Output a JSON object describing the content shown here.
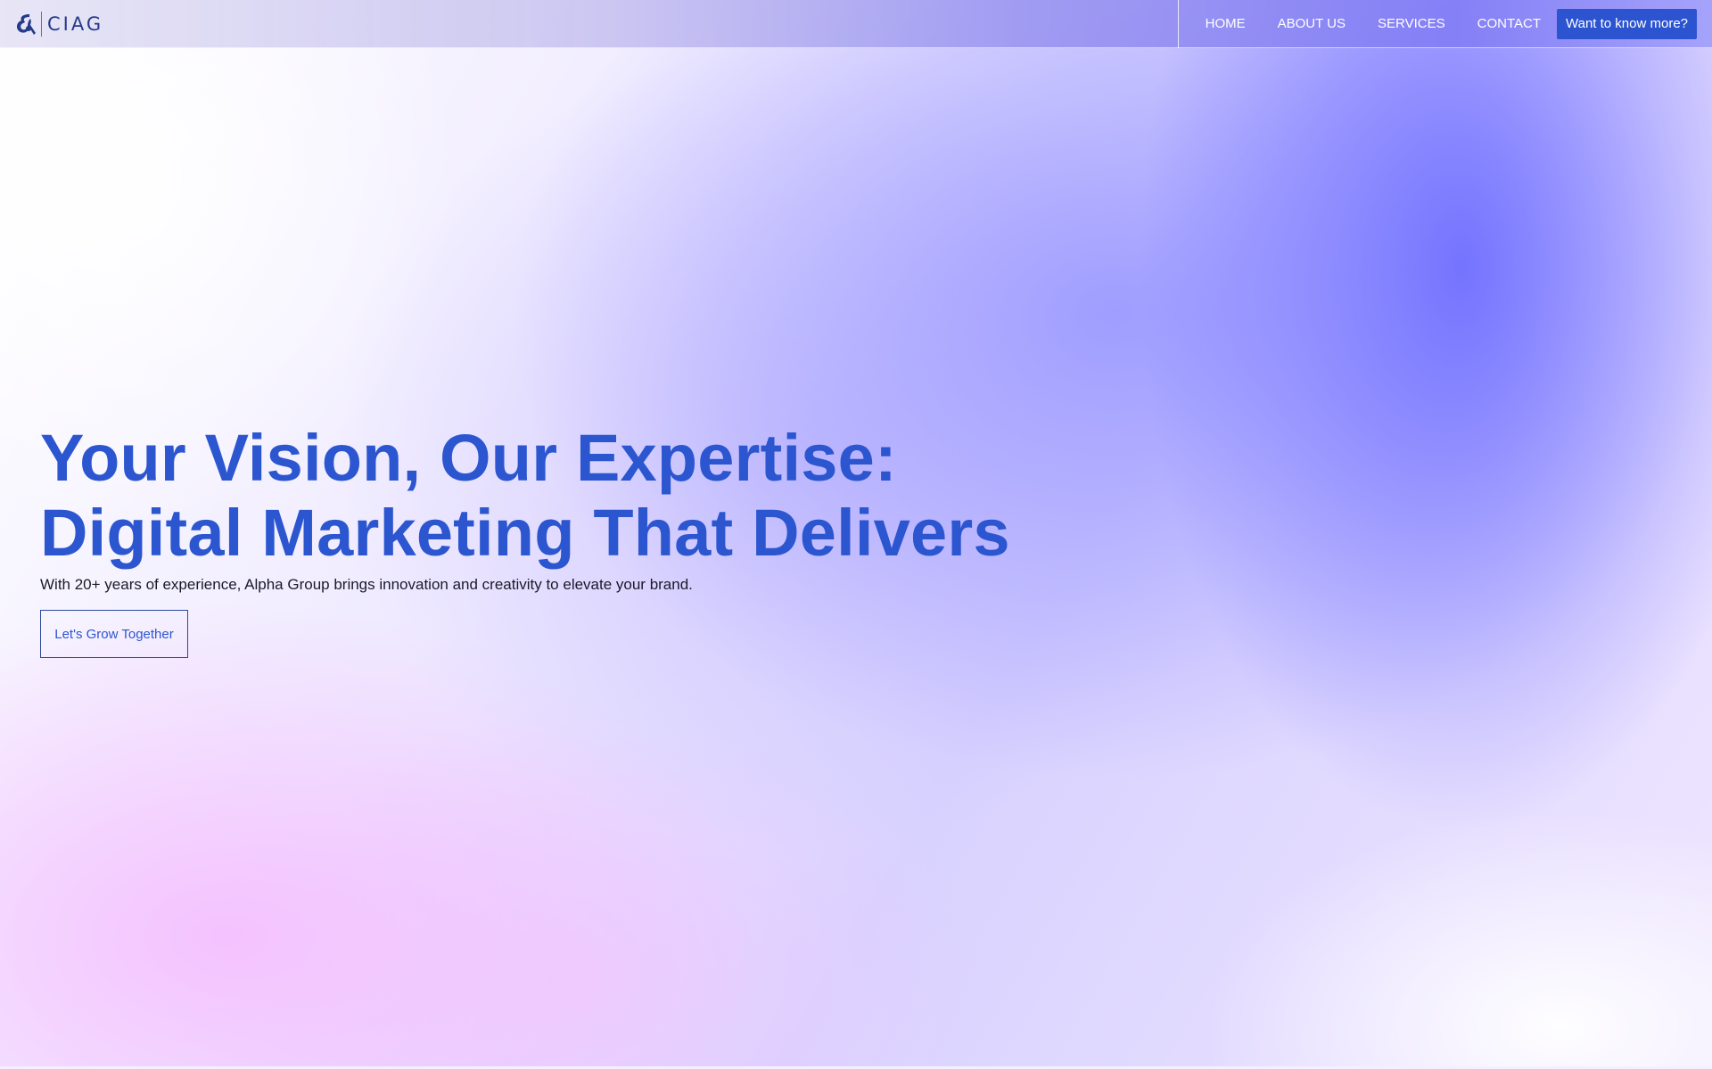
{
  "brand": {
    "name": "CIAG",
    "logo_icon": "alpha-ampersand-logo-icon",
    "color": "#263a8c"
  },
  "nav": {
    "items": [
      {
        "label": "HOME"
      },
      {
        "label": "ABOUT US"
      },
      {
        "label": "SERVICES"
      },
      {
        "label": "CONTACT"
      }
    ],
    "cta_label": "Want to know more?"
  },
  "hero": {
    "title_line1": "Your Vision, Our Expertise:",
    "title_line2": "Digital Marketing That Delivers",
    "subtitle": "With 20+ years of experience, Alpha Group brings innovation and creativity to elevate your brand.",
    "button_label": "Let's Grow Together"
  },
  "colors": {
    "accent": "#2c56d0",
    "cta_bg": "#2c54d1",
    "text": "#1a1a2a"
  }
}
